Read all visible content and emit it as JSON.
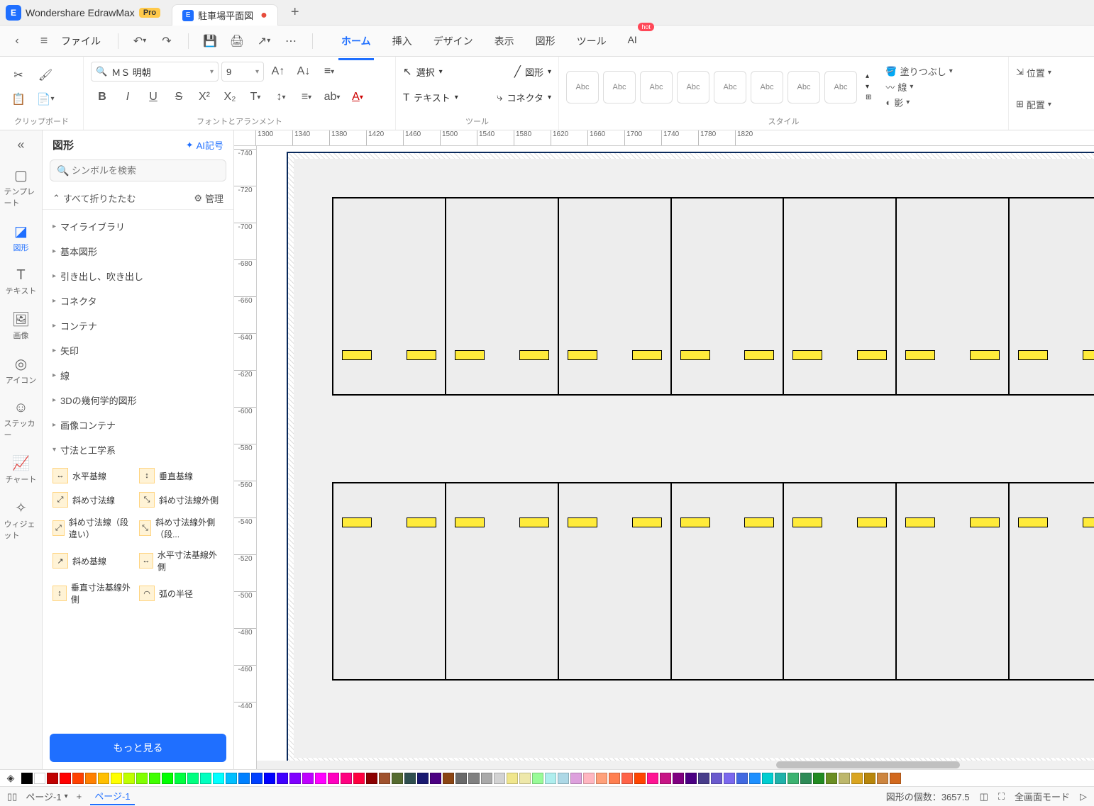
{
  "app": {
    "title": "Wondershare EdrawMax",
    "pro": "Pro"
  },
  "tab": {
    "name": "駐車場平面図",
    "dirty": "●"
  },
  "menubar": {
    "file": "ファイル"
  },
  "menutabs": {
    "home": "ホーム",
    "insert": "挿入",
    "design": "デザイン",
    "view": "表示",
    "shapes": "図形",
    "tools": "ツール",
    "ai": "AI",
    "hot": "hot"
  },
  "ribbon": {
    "clipboard_label": "クリップボード",
    "font_label": "フォントとアランメント",
    "font_name": "ＭＳ 明朝",
    "font_size": "9",
    "tool_label": "ツール",
    "select": "選択",
    "text": "テキスト",
    "shapes": "図形",
    "connector": "コネクタ",
    "style_label": "スタイル",
    "style_sample": "Abc",
    "fill": "塗りつぶし",
    "line": "線",
    "shadow": "影",
    "position": "位置",
    "align": "配置"
  },
  "rail": {
    "template": "テンプレート",
    "shape": "図形",
    "text": "テキスト",
    "image": "画像",
    "icon": "アイコン",
    "sticker": "ステッカー",
    "chart": "チャート",
    "widget": "ウィジェット"
  },
  "sidepanel": {
    "title": "図形",
    "ai": "AI記号",
    "search_placeholder": "シンボルを検索",
    "collapse_all": "すべて折りたたむ",
    "manage": "管理",
    "categories": [
      "マイライブラリ",
      "基本図形",
      "引き出し、吹き出し",
      "コネクタ",
      "コンテナ",
      "矢印",
      "線",
      "3Dの幾何学的図形",
      "画像コンテナ",
      "寸法と工学系"
    ],
    "dim_items": [
      "水平基線",
      "垂直基線",
      "斜め寸法線",
      "斜め寸法線外側",
      "斜め寸法線（段違い）",
      "斜め寸法線外側（段...",
      "斜め基線",
      "水平寸法基線外側",
      "垂直寸法基線外側",
      "弧の半径"
    ],
    "more": "もっと見る"
  },
  "ruler_h": [
    1300,
    1340,
    1380,
    1420,
    1460,
    1500,
    1540,
    1580,
    1620,
    1660,
    1700,
    1740,
    1780,
    1820
  ],
  "ruler_v": [
    -740,
    -720,
    -700,
    -680,
    -660,
    -640,
    -620,
    -600,
    -580,
    -560,
    -540,
    -520,
    -500,
    -480,
    -460,
    -440
  ],
  "statusbar": {
    "page_dd": "ページ-1",
    "page_tab": "ページ-1",
    "shape_count_label": "図形の個数：",
    "shape_count": "3657.5",
    "fullscreen": "全画面モード"
  },
  "colors": [
    "#000000",
    "#ffffff",
    "#c00000",
    "#ff0000",
    "#ff4000",
    "#ff8000",
    "#ffbf00",
    "#ffff00",
    "#bfff00",
    "#80ff00",
    "#40ff00",
    "#00ff00",
    "#00ff40",
    "#00ff80",
    "#00ffbf",
    "#00ffff",
    "#00bfff",
    "#0080ff",
    "#0040ff",
    "#0000ff",
    "#4000ff",
    "#8000ff",
    "#bf00ff",
    "#ff00ff",
    "#ff00bf",
    "#ff0080",
    "#ff0040",
    "#8b0000",
    "#a0522d",
    "#556b2f",
    "#2f4f4f",
    "#191970",
    "#4b0082",
    "#8b4513",
    "#696969",
    "#808080",
    "#a9a9a9",
    "#d3d3d3",
    "#f0e68c",
    "#eee8aa",
    "#98fb98",
    "#afeeee",
    "#add8e6",
    "#dda0dd",
    "#ffb6c1",
    "#ffa07a",
    "#ff7f50",
    "#ff6347",
    "#ff4500",
    "#ff1493",
    "#c71585",
    "#800080",
    "#4b0082",
    "#483d8b",
    "#6a5acd",
    "#7b68ee",
    "#4169e1",
    "#1e90ff",
    "#00ced1",
    "#20b2aa",
    "#3cb371",
    "#2e8b57",
    "#228b22",
    "#6b8e23",
    "#bdb76b",
    "#daa520",
    "#b8860b",
    "#cd853f",
    "#d2691e"
  ]
}
